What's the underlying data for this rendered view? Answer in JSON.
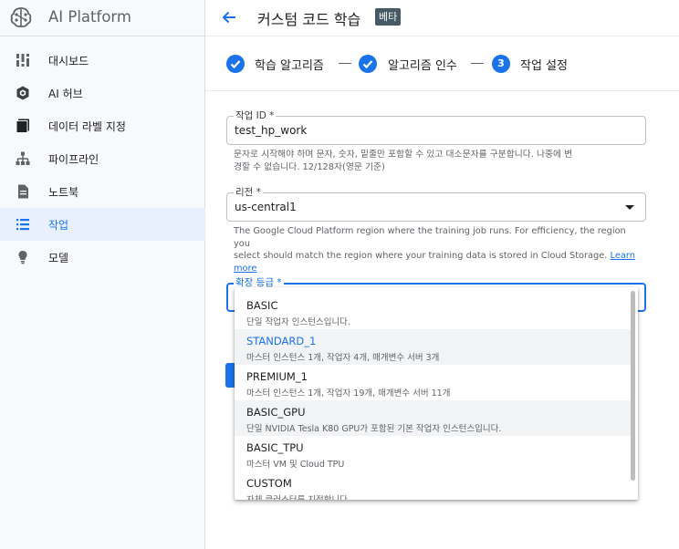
{
  "app": {
    "title": "AI Platform"
  },
  "sidebar": {
    "items": [
      {
        "label": "대시보드",
        "icon": "dashboard-icon"
      },
      {
        "label": "AI 허브",
        "icon": "hub-icon"
      },
      {
        "label": "데이터 라벨 지정",
        "icon": "label-icon"
      },
      {
        "label": "파이프라인",
        "icon": "pipeline-icon"
      },
      {
        "label": "노트북",
        "icon": "notebook-icon"
      },
      {
        "label": "작업",
        "icon": "jobs-icon",
        "active": true
      },
      {
        "label": "모델",
        "icon": "model-icon"
      }
    ]
  },
  "header": {
    "title": "커스텀 코드 학습",
    "badge": "베타"
  },
  "stepper": {
    "steps": [
      {
        "label": "학습 알고리즘",
        "state": "done"
      },
      {
        "label": "알고리즘 인수",
        "state": "done"
      },
      {
        "label": "작업 설정",
        "state": "current",
        "number": "3"
      }
    ],
    "separator": "—"
  },
  "form": {
    "job_id": {
      "label": "작업 ID *",
      "value": "test_hp_work",
      "hint_line1": "문자로 시작해야 하며 문자, 숫자, 밑줄만 포함할 수 있고 대소문자를 구분합니다. 나중에 변",
      "hint_line2": "경할 수 없습니다. 12/128자(영문 기준)"
    },
    "region": {
      "label": "리전 *",
      "value": "us-central1",
      "hint_line1": "The Google Cloud Platform region where the training job runs. For efficiency, the region you",
      "hint_line2": "select should match the region where your training data is stored in Cloud Storage.",
      "hint_link_a": "Learn",
      "hint_link_b": "more"
    },
    "scale_tier": {
      "label": "확장 등급 *"
    }
  },
  "dropdown": {
    "options": [
      {
        "title": "BASIC",
        "desc": "단일 작업자 인스턴스입니다."
      },
      {
        "title": "STANDARD_1",
        "desc": "마스터 인스턴스 1개, 작업자 4개, 매개변수 서버 3개",
        "selected": true
      },
      {
        "title": "PREMIUM_1",
        "desc": "마스터 인스턴스 1개, 작업자 19개, 매개변수 서버 11개"
      },
      {
        "title": "BASIC_GPU",
        "desc": "단일 NVIDIA Tesla K80 GPU가 포함된 기본 작업자 인스턴스입니다."
      },
      {
        "title": "BASIC_TPU",
        "desc": "마스터 VM 및 Cloud TPU"
      },
      {
        "title": "CUSTOM",
        "desc": "자체 클러스터를 지정합니다."
      }
    ]
  },
  "colors": {
    "accent": "#1a73e8",
    "badge": "#455a64",
    "sidebar_bg": "#f8f9fa",
    "active_bg": "#e8f0fe"
  }
}
